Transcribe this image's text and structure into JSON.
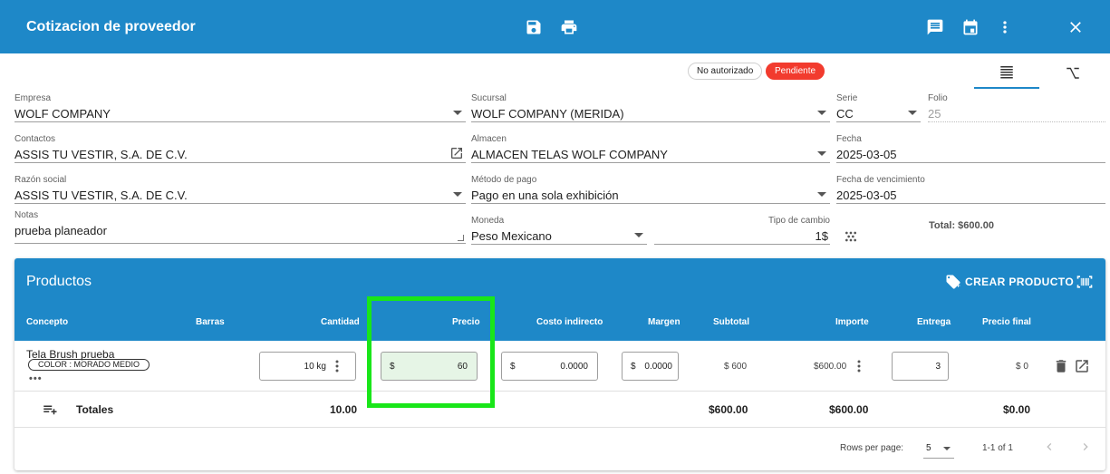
{
  "header": {
    "title": "Cotizacion de proveedor"
  },
  "status": {
    "authorization": "No autorizado",
    "state": "Pendiente"
  },
  "form": {
    "empresa": {
      "label": "Empresa",
      "value": "WOLF COMPANY"
    },
    "sucursal": {
      "label": "Sucursal",
      "value": "WOLF COMPANY (MERIDA)"
    },
    "serie": {
      "label": "Serie",
      "value": "CC"
    },
    "folio": {
      "label": "Folio",
      "value": "25"
    },
    "contactos": {
      "label": "Contactos",
      "value": "ASSIS TU VESTIR, S.A. DE C.V."
    },
    "almacen": {
      "label": "Almacen",
      "value": "ALMACEN TELAS WOLF COMPANY"
    },
    "fecha": {
      "label": "Fecha",
      "value": "2025-03-05"
    },
    "razon_social": {
      "label": "Razón social",
      "value": "ASSIS TU VESTIR, S.A. DE C.V."
    },
    "metodo_pago": {
      "label": "Método de pago",
      "value": "Pago en una sola exhibición"
    },
    "fecha_vencimiento": {
      "label": "Fecha de vencimiento",
      "value": "2025-03-05"
    },
    "notas": {
      "label": "Notas",
      "value": "prueba planeador"
    },
    "moneda": {
      "label": "Moneda",
      "value": "Peso Mexicano"
    },
    "tipo_cambio": {
      "label": "Tipo de cambio",
      "value": "1$"
    },
    "total": "Total: $600.00"
  },
  "products": {
    "title": "Productos",
    "create_label": "CREAR PRODUCTO",
    "columns": {
      "concepto": "Concepto",
      "barras": "Barras",
      "cantidad": "Cantidad",
      "precio": "Precio",
      "costo_indirecto": "Costo indirecto",
      "margen": "Margen",
      "subtotal": "Subtotal",
      "importe": "Importe",
      "entrega": "Entrega",
      "precio_final": "Precio final"
    },
    "rows": [
      {
        "concepto": "Tela Brush prueba",
        "tag": "COLOR : MORADO MEDIO",
        "more": "•••",
        "cantidad": "10 kg",
        "precio_prefix": "$",
        "precio": "60",
        "costo_prefix": "$",
        "costo_indirecto": "0.0000",
        "margen_prefix": "$",
        "margen": "0.0000",
        "subtotal": "$ 600",
        "importe": "$600.00",
        "entrega": "3",
        "precio_final": "$ 0"
      }
    ],
    "totals": {
      "label": "Totales",
      "cantidad": "10.00",
      "subtotal": "$600.00",
      "importe": "$600.00",
      "precio_final": "$0.00"
    },
    "pagination": {
      "rows_per_page_label": "Rows per page:",
      "rows_per_page": "5",
      "range": "1-1 of 1"
    }
  },
  "highlight_color": "#19e619",
  "accent_color": "#1e88c8"
}
